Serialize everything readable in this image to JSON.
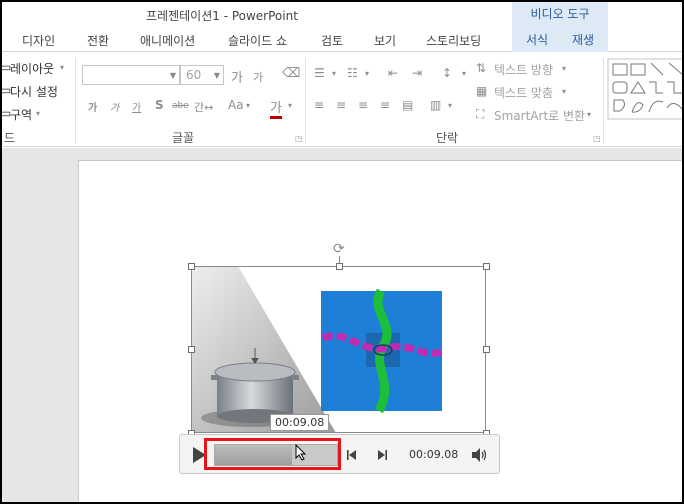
{
  "window": {
    "title": "프레젠테이션1 - PowerPoint",
    "context_group": "비디오 도구"
  },
  "tabs": [
    {
      "label": "디자인"
    },
    {
      "label": "전환"
    },
    {
      "label": "애니메이션"
    },
    {
      "label": "슬라이드 쇼"
    },
    {
      "label": "검토"
    },
    {
      "label": "보기"
    },
    {
      "label": "스토리보딩"
    },
    {
      "label": "서식",
      "context": true
    },
    {
      "label": "재생",
      "context": true
    }
  ],
  "ribbon": {
    "slides_group": {
      "layout_label": "레이아웃",
      "reset_label": "다시 설정",
      "section_label": "구역",
      "group_label": "드"
    },
    "font_group": {
      "font_name_value": "",
      "font_size_value": "60",
      "group_label": "글꼴"
    },
    "paragraph_group": {
      "text_direction_label": "텍스트 방향",
      "align_text_label": "텍스트 맞춤",
      "smartart_label": "SmartArt로 변환",
      "group_label": "단락"
    }
  },
  "video": {
    "tooltip_time": "00:09.08",
    "time_display": "00:09.08",
    "progress_fraction": 0.63
  },
  "colors": {
    "highlight": "#e8141c",
    "context_tab_bg": "#dde9f5",
    "context_tab_text": "#2a5d9f",
    "video_blue": "#1e7fd6"
  }
}
